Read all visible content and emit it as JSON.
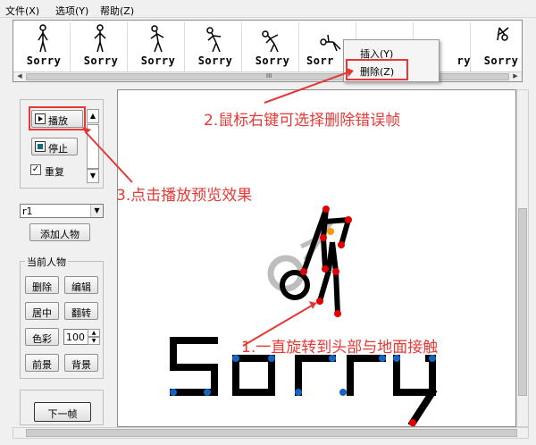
{
  "menu": {
    "file": "文件(X)",
    "options": "选项(Y)",
    "help": "帮助(Z)"
  },
  "frames": {
    "label": "Sorry",
    "partial_label": "Sorr",
    "count_visible": 9
  },
  "context_menu": {
    "insert": "插入(Y)",
    "delete": "删除(Z)"
  },
  "controls": {
    "play": "播放",
    "stop": "停止",
    "repeat": "重复",
    "repeat_checked": "✓",
    "figure_select": "r1",
    "add_figure": "添加人物",
    "current_figure_group": "当前人物",
    "delete": "删除",
    "edit": "编辑",
    "center": "居中",
    "flip": "翻转",
    "color": "色彩",
    "opacity_value": "100",
    "foreground": "前景",
    "background": "背景",
    "next_frame": "下一帧"
  },
  "canvas_text": "Sorry",
  "annotations": {
    "a1": "1.一直旋转到头部与地面接触",
    "a2": "2.鼠标右键可选择删除错误帧",
    "a3": "3.点击播放预览效果"
  },
  "colors": {
    "annotation": "#e53935",
    "joint_red": "#e00000",
    "joint_blue": "#1565c0",
    "joint_orange": "#ff9800",
    "ghost": "#bdbdbd"
  }
}
